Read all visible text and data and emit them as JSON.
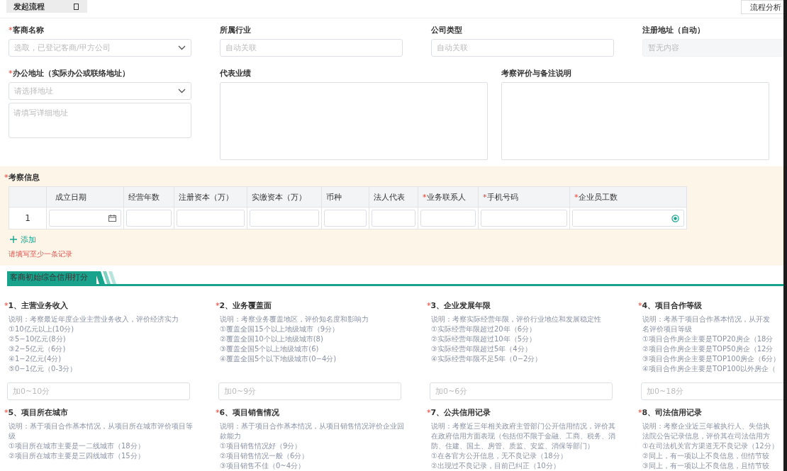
{
  "required_marker": "*",
  "top_bar": {
    "tabs": [
      {
        "label": "发起流程",
        "selected": true
      }
    ],
    "right_button": "流程分析"
  },
  "form_row_1": [
    {
      "label": "客商名称",
      "required": true,
      "kind": "select",
      "placeholder": "选取，已登记客商/甲方公司"
    },
    {
      "label": "所属行业",
      "required": false,
      "kind": "input",
      "placeholder": "自动关联"
    },
    {
      "label": "公司类型",
      "required": false,
      "kind": "input",
      "placeholder": "自动关联"
    },
    {
      "label": "注册地址（自动）",
      "required": false,
      "kind": "readonly",
      "placeholder": "暂无内容"
    }
  ],
  "office_address": {
    "label": "办公地址（实际办公或联络地址）",
    "required": true,
    "select_placeholder": "请选择地址",
    "detail_placeholder": "请填写详细地址"
  },
  "text_areas": [
    {
      "label": "代表业绩",
      "required": false
    },
    {
      "label": "考察评价与备注说明",
      "required": false
    }
  ],
  "inspection": {
    "title": "考察信息",
    "required": true,
    "columns": [
      {
        "label": "成立日期",
        "required": false
      },
      {
        "label": "经营年数",
        "required": false
      },
      {
        "label": "注册资本（万）",
        "required": false
      },
      {
        "label": "实缴资本（万）",
        "required": false
      },
      {
        "label": "币种",
        "required": false
      },
      {
        "label": "法人代表",
        "required": false
      },
      {
        "label": "业务联系人",
        "required": true
      },
      {
        "label": "手机号码",
        "required": true
      },
      {
        "label": "企业员工数",
        "required": true
      }
    ],
    "rows": [
      {
        "index": "1",
        "cells": [
          {
            "kind": "date"
          },
          {
            "kind": "text"
          },
          {
            "kind": "text"
          },
          {
            "kind": "text"
          },
          {
            "kind": "text"
          },
          {
            "kind": "text"
          },
          {
            "kind": "text"
          },
          {
            "kind": "text"
          },
          {
            "kind": "picker"
          }
        ]
      }
    ],
    "add_button": "添加",
    "error": "请填写至少一条记录"
  },
  "section_banner": "客商初始综合信用打分",
  "score_items": [
    {
      "title": "1、主营业务收入",
      "required": true,
      "description": [
        "说明：考察最近年度企业主营业务收入，评价经济实力"
      ],
      "options": [
        "①10亿元以上(10分)",
        "②5−10亿元(8分)",
        "③2−5亿元（6分)",
        "④1−2亿元(4分)",
        "⑤0−1亿元（0-3分）"
      ],
      "placeholder": "加0~10分"
    },
    {
      "title": "2、业务覆盖面",
      "required": true,
      "description": [
        "说明：考察业务覆盖地区，评价知名度和影响力"
      ],
      "options": [
        "①覆盖全国15个以上地级城市（9分）",
        "②覆盖全国10个以上地级城市(8)",
        "③覆盖全国5个以上地级城市(6)",
        "④覆盖全国5个以下地级城市(0−4分)"
      ],
      "placeholder": "加0~9分"
    },
    {
      "title": "3、企业发展年限",
      "required": true,
      "description": [
        "说明：考察实际经营年限，评价行业地位和发展稳定性"
      ],
      "options": [
        "①实际经营年限超过20年（6分）",
        "②实际经营年限超过10年（5分）",
        "③实际经营年限超过5年（4分）",
        "④实际经营年限不足5年（0−2分）"
      ],
      "placeholder": "加0~6分"
    },
    {
      "title": "4、项目合作等级",
      "required": true,
      "description": [
        "说明：考基于项目合作基本情况，从开发",
        "名评价项目等级"
      ],
      "options": [
        "①项目合作房企主要是TOP20房企（18分",
        "②项目合作房企主要是TOP50房企（12分",
        "③项目合作房企主要是TOP100房企（6分）",
        "④项目合作房企主要是TOP100以外房企（"
      ],
      "placeholder": "加0~18分"
    },
    {
      "title": "5、项目所在城市",
      "required": true,
      "description": [
        "说明：基于项目合作基本情况，从项目所在城市评价项目等",
        "级"
      ],
      "options": [
        "①项目所在城市主要是一二线城市（18分）",
        "②项目所在城市主要是三四线城市（15分）"
      ]
    },
    {
      "title": "6、项目销售情况",
      "required": true,
      "description": [
        "说明：基于项目合作基本情况，从项目销售情况评价企业回",
        "款能力"
      ],
      "options": [
        "①项目销售情况好（9分）",
        "②项目销售情况一般（6分）",
        "③项目销售不佳（0~4分）"
      ]
    },
    {
      "title": "7、公共信用记录",
      "required": true,
      "description": [
        "说明：考察近三年相关政府主管部门公开信用情况，评价其",
        "在政府信用方面表现（包括但不限于金融、工商、税务、消",
        "防、住建、国土、房管、质监、安监、消保等部门）"
      ],
      "options": [
        "①在各官方公开信息，无不良记录（18分）",
        "②出现过不良记录，目前已纠正（10分）"
      ]
    },
    {
      "title": "8、司法信用记录",
      "required": true,
      "description": [
        "说明：考察企业近三年被执行人、失信执",
        "法院公告记录信息，评价其在司法信用方"
      ],
      "options": [
        "①在司法机关官方渠道无不良记录（12分）",
        "②同上，有一项以上不良信息，但情节较",
        "③同上，有一项以上不良信息，且情节较"
      ]
    }
  ]
}
